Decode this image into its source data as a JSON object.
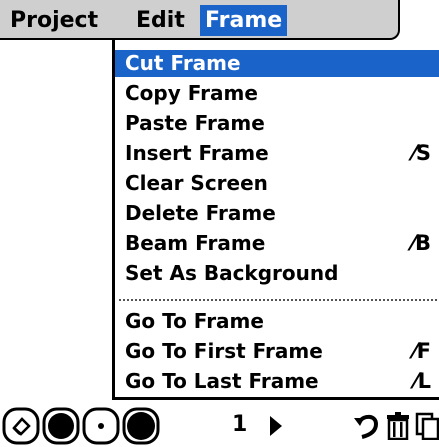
{
  "menubar": {
    "items": [
      {
        "label": "Project"
      },
      {
        "label": "Edit"
      },
      {
        "label": "Frame"
      }
    ]
  },
  "frame_menu": {
    "items": [
      {
        "label": "Cut Frame",
        "shortcut": "",
        "selected": true
      },
      {
        "label": "Copy Frame",
        "shortcut": ""
      },
      {
        "label": "Paste Frame",
        "shortcut": ""
      },
      {
        "label": "Insert Frame",
        "shortcut": "S"
      },
      {
        "label": "Clear Screen",
        "shortcut": ""
      },
      {
        "label": "Delete Frame",
        "shortcut": ""
      },
      {
        "label": "Beam Frame",
        "shortcut": "B"
      },
      {
        "label": "Set As Background",
        "shortcut": ""
      },
      {
        "label": "Go To Frame",
        "shortcut": ""
      },
      {
        "label": "Go To First Frame",
        "shortcut": "F"
      },
      {
        "label": "Go To Last Frame",
        "shortcut": "L"
      }
    ]
  },
  "toolbar": {
    "frame_number": "1",
    "icons": [
      "eraser-icon",
      "large-brush-icon",
      "small-brush-icon",
      "ink-color-icon",
      "play-icon",
      "undo-icon",
      "trash-icon",
      "copy-icon"
    ]
  },
  "colors": {
    "selection": "#1a63c9",
    "menubar": "#cfcfcf"
  }
}
